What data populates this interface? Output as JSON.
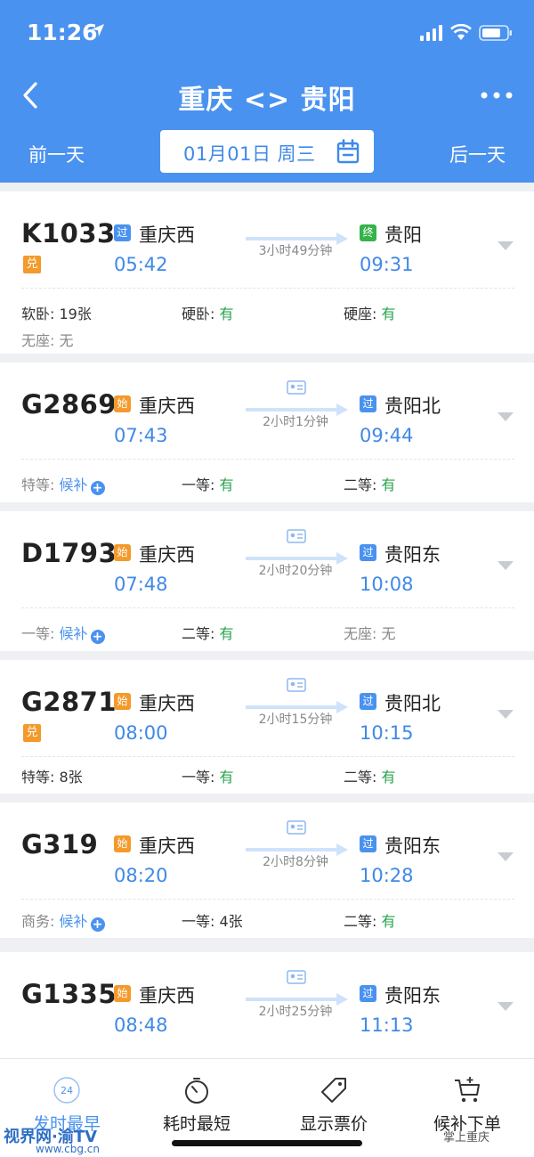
{
  "status_bar": {
    "time": "11:26"
  },
  "header": {
    "title": "重庆 <> 贵阳",
    "prev_day": "前一天",
    "next_day": "后一天",
    "date": "01月01日 周三"
  },
  "trains": [
    {
      "no": "K1033",
      "exchange": "兑",
      "dep_tag": "过",
      "dep_station": "重庆西",
      "dep_time": "05:42",
      "duration": "3小时49分钟",
      "arr_tag": "终",
      "arr_station": "贵阳",
      "arr_time": "09:31",
      "seats": [
        {
          "label": "软卧:",
          "value": "19张"
        },
        {
          "label": "硬卧:",
          "value": "有"
        },
        {
          "label": "硬座:",
          "value": "有"
        },
        {
          "label": "无座:",
          "value": "无"
        }
      ]
    },
    {
      "no": "G2869",
      "dep_tag": "始",
      "dep_station": "重庆西",
      "dep_time": "07:43",
      "duration": "2小时1分钟",
      "arr_tag": "过",
      "arr_station": "贵阳北",
      "arr_time": "09:44",
      "seats": [
        {
          "label": "特等:",
          "value": "候补"
        },
        {
          "label": "一等:",
          "value": "有"
        },
        {
          "label": "二等:",
          "value": "有"
        }
      ]
    },
    {
      "no": "D1793",
      "dep_tag": "始",
      "dep_station": "重庆西",
      "dep_time": "07:48",
      "duration": "2小时20分钟",
      "arr_tag": "过",
      "arr_station": "贵阳东",
      "arr_time": "10:08",
      "seats": [
        {
          "label": "一等:",
          "value": "候补"
        },
        {
          "label": "二等:",
          "value": "有"
        },
        {
          "label": "无座:",
          "value": "无"
        }
      ]
    },
    {
      "no": "G2871",
      "exchange": "兑",
      "dep_tag": "始",
      "dep_station": "重庆西",
      "dep_time": "08:00",
      "duration": "2小时15分钟",
      "arr_tag": "过",
      "arr_station": "贵阳北",
      "arr_time": "10:15",
      "seats": [
        {
          "label": "特等:",
          "value": "8张"
        },
        {
          "label": "一等:",
          "value": "有"
        },
        {
          "label": "二等:",
          "value": "有"
        }
      ]
    },
    {
      "no": "G319",
      "dep_tag": "始",
      "dep_station": "重庆西",
      "dep_time": "08:20",
      "duration": "2小时8分钟",
      "arr_tag": "过",
      "arr_station": "贵阳东",
      "arr_time": "10:28",
      "seats": [
        {
          "label": "商务:",
          "value": "候补"
        },
        {
          "label": "一等:",
          "value": "4张"
        },
        {
          "label": "二等:",
          "value": "有"
        }
      ]
    },
    {
      "no": "G1335",
      "dep_tag": "始",
      "dep_station": "重庆西",
      "dep_time": "08:48",
      "duration": "2小时25分钟",
      "arr_tag": "过",
      "arr_station": "贵阳东",
      "arr_time": "11:13",
      "seats": []
    }
  ],
  "tabs": [
    {
      "label": "发时最早",
      "icon": "clock-24-icon",
      "badge": "24"
    },
    {
      "label": "耗时最短",
      "icon": "stopwatch-icon"
    },
    {
      "label": "显示票价",
      "icon": "price-tag-icon"
    },
    {
      "label": "候补下单",
      "icon": "cart-plus-icon"
    }
  ],
  "watermark": {
    "left": "视界网·渝TV",
    "left_sub": "www.cbg.cn",
    "right": "掌上重庆"
  },
  "colors": {
    "brand_blue": "#4a92ef",
    "available_green": "#27a34b",
    "start_orange": "#f39a2b",
    "terminal_green": "#36b24a"
  }
}
